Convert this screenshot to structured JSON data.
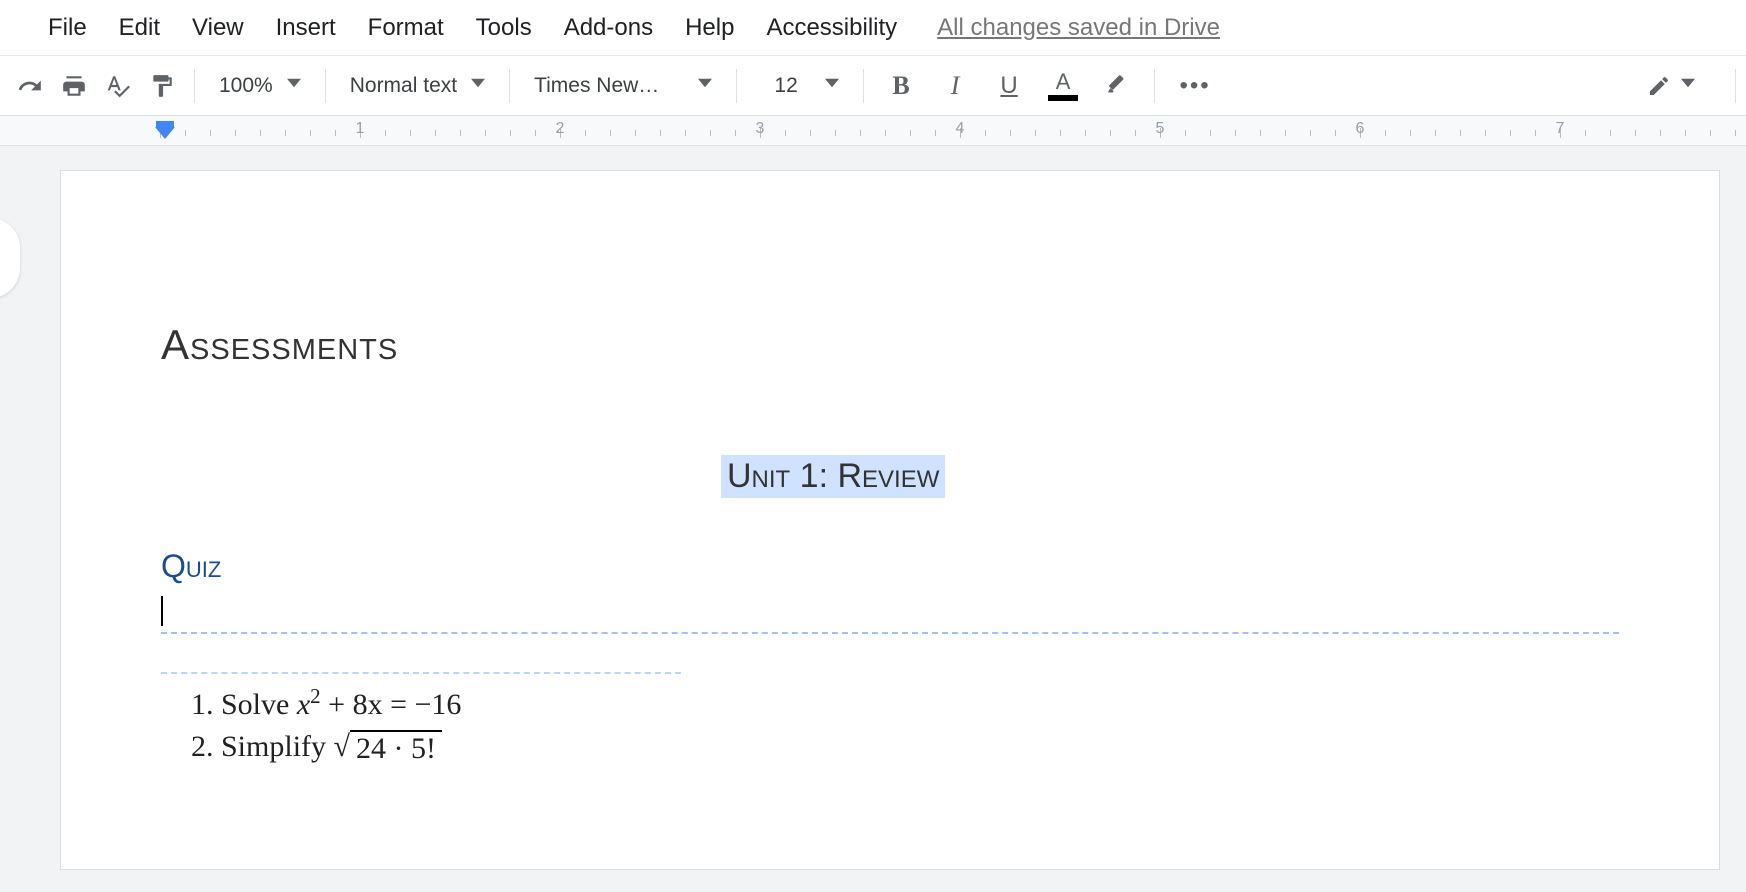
{
  "menu": {
    "items": [
      "File",
      "Edit",
      "View",
      "Insert",
      "Format",
      "Tools",
      "Add-ons",
      "Help",
      "Accessibility"
    ],
    "save_status": "All changes saved in Drive"
  },
  "toolbar": {
    "zoom": "100%",
    "style": "Normal text",
    "font": "Times New…",
    "font_size": "12",
    "bold_glyph": "B",
    "italic_glyph": "I",
    "underline_glyph": "U",
    "textcolor_glyph": "A",
    "more_glyph": "•••"
  },
  "ruler": {
    "labels": [
      "1",
      "2",
      "3",
      "4",
      "5",
      "6",
      "7"
    ]
  },
  "document": {
    "heading_main": "Assessments",
    "heading_unit": "Unit 1: Review",
    "heading_quiz": "Quiz",
    "questions": {
      "q1_prefix": "Solve ",
      "q1_math_var": "x",
      "q1_math_exp": "2",
      "q1_math_rest": " + 8x = −16",
      "q2_prefix": "Simplify ",
      "q2_radicand": "24 · 5!",
      "q2_surd": "√"
    }
  }
}
